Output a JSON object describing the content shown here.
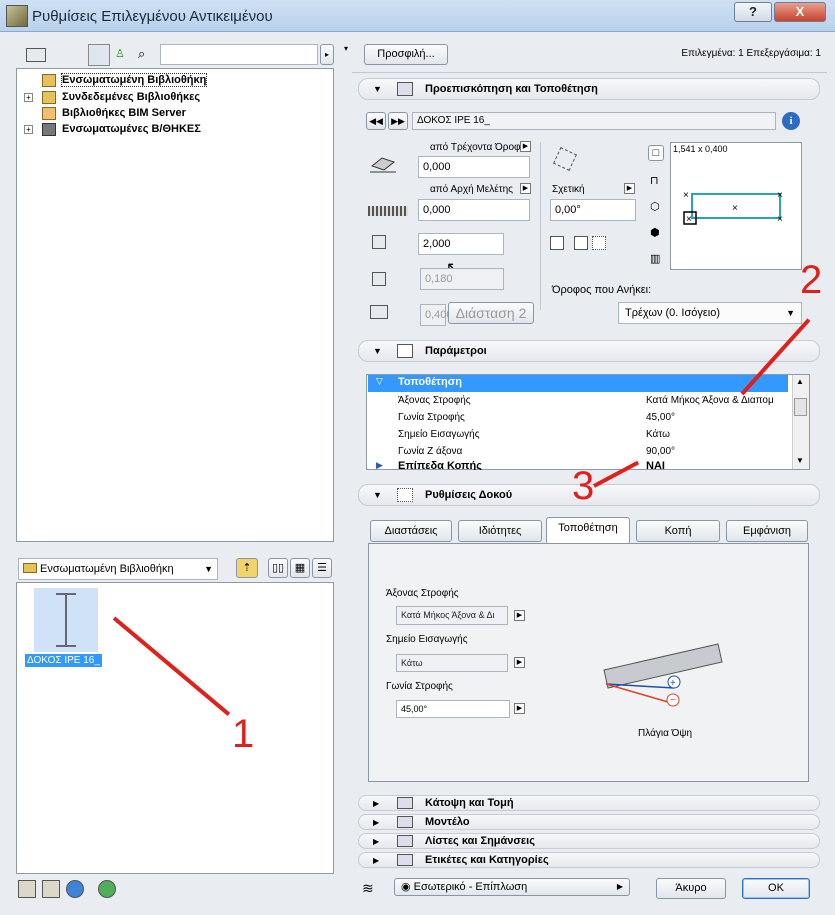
{
  "window": {
    "title": "Ρυθμίσεις Επιλεγμένου Αντικειμένου",
    "help": "?",
    "minimize": "_",
    "close": "X"
  },
  "library_tree": {
    "items": [
      {
        "label": "Ενσωματωμένη Βιβλιοθήκη",
        "expand": ""
      },
      {
        "label": "Συνδεδεμένες Βιβλιοθήκες",
        "expand": "+"
      },
      {
        "label": "Βιβλιοθήκες BIM Server",
        "expand": ""
      },
      {
        "label": "Ενσωματωμένες Β/ΘΗΚΕΣ",
        "expand": "+"
      }
    ]
  },
  "library_select": {
    "value": "Ενσωματωμένη Βιβλιοθήκη"
  },
  "object_item": {
    "label": "ΔΟΚΟΣ IPE 16_"
  },
  "header": {
    "profile_button": "Προσφιλή...",
    "selection_info": "Επιλεγμένα: 1 Επεξεργάσιμα: 1"
  },
  "sections": {
    "preview": "Προεπισκόπηση και Τοποθέτηση",
    "params": "Παράμετροι",
    "beam": "Ρυθμίσεις Δοκού",
    "floorplan": "Κάτοψη και Τομή",
    "model": "Μοντέλο",
    "lists": "Λίστες και Σημάνσεις",
    "tags": "Ετικέτες και Κατηγορίες"
  },
  "preview": {
    "object_name": "ΔΟΚΟΣ IPE 16_",
    "from_floor_label": "από Τρέχοντα Όροφο",
    "from_floor_value": "0,000",
    "from_origin_label": "από Αρχή Μελέτης",
    "from_origin_value": "0,000",
    "relative_label": "Σχετική",
    "angle_value": "0,00°",
    "length_value": "2,000",
    "height_value": "0,180",
    "width_value": "0,400",
    "dimension2": "Διάσταση 2",
    "size_readout": "1,541 x 0,400",
    "story_label": "Όροφος που Ανήκει:",
    "story_value": "Τρέχων (0. Ισόγειο)"
  },
  "params": {
    "group": "Τοποθέτηση",
    "rows": [
      {
        "key": "Άξονας Στροφής",
        "value": "Κατά Μήκος Άξονα & Διαπομ"
      },
      {
        "key": "Γωνία Στροφής",
        "value": "45,00°"
      },
      {
        "key": "Σημείο Εισαγωγής",
        "value": "Κάτω"
      },
      {
        "key": "Γωνία Ζ άξονα",
        "value": "90,00°"
      }
    ],
    "next_group": "Επίπεδα Κοπής",
    "next_value": "ΝΑΙ"
  },
  "beam_tabs": {
    "dims": "Διαστάσεις",
    "props": "Ιδιότητες",
    "placement": "Τοποθέτηση",
    "cut": "Κοπή",
    "appearance": "Εμφάνιση"
  },
  "beam_panel": {
    "axis_label": "Άξονας Στροφής",
    "axis_value": "Κατά Μήκος Άξονα & Δι",
    "insert_label": "Σημείο Εισαγωγής",
    "insert_value": "Κάτω",
    "angle_label": "Γωνία Στροφής",
    "angle_value": "45,00°",
    "side_view": "Πλάγια Όψη"
  },
  "footer": {
    "layer_value": "Εσωτερικό - Επίπλωση",
    "cancel": "Άκυρο",
    "ok": "OK"
  },
  "annotations": {
    "n1": "1",
    "n2": "2",
    "n3": "3"
  },
  "colors": {
    "selection": "#3399ff",
    "annotation": "#e0201b"
  }
}
